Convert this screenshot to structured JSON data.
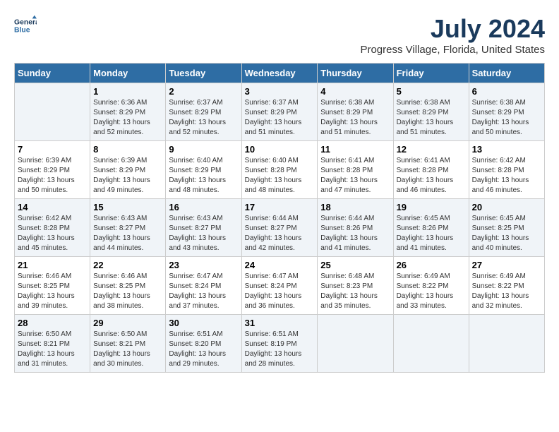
{
  "header": {
    "logo_line1": "General",
    "logo_line2": "Blue",
    "title": "July 2024",
    "subtitle": "Progress Village, Florida, United States"
  },
  "calendar": {
    "days_of_week": [
      "Sunday",
      "Monday",
      "Tuesday",
      "Wednesday",
      "Thursday",
      "Friday",
      "Saturday"
    ],
    "weeks": [
      [
        {
          "day": "",
          "info": ""
        },
        {
          "day": "1",
          "info": "Sunrise: 6:36 AM\nSunset: 8:29 PM\nDaylight: 13 hours\nand 52 minutes."
        },
        {
          "day": "2",
          "info": "Sunrise: 6:37 AM\nSunset: 8:29 PM\nDaylight: 13 hours\nand 52 minutes."
        },
        {
          "day": "3",
          "info": "Sunrise: 6:37 AM\nSunset: 8:29 PM\nDaylight: 13 hours\nand 51 minutes."
        },
        {
          "day": "4",
          "info": "Sunrise: 6:38 AM\nSunset: 8:29 PM\nDaylight: 13 hours\nand 51 minutes."
        },
        {
          "day": "5",
          "info": "Sunrise: 6:38 AM\nSunset: 8:29 PM\nDaylight: 13 hours\nand 51 minutes."
        },
        {
          "day": "6",
          "info": "Sunrise: 6:38 AM\nSunset: 8:29 PM\nDaylight: 13 hours\nand 50 minutes."
        }
      ],
      [
        {
          "day": "7",
          "info": "Sunrise: 6:39 AM\nSunset: 8:29 PM\nDaylight: 13 hours\nand 50 minutes."
        },
        {
          "day": "8",
          "info": "Sunrise: 6:39 AM\nSunset: 8:29 PM\nDaylight: 13 hours\nand 49 minutes."
        },
        {
          "day": "9",
          "info": "Sunrise: 6:40 AM\nSunset: 8:29 PM\nDaylight: 13 hours\nand 48 minutes."
        },
        {
          "day": "10",
          "info": "Sunrise: 6:40 AM\nSunset: 8:28 PM\nDaylight: 13 hours\nand 48 minutes."
        },
        {
          "day": "11",
          "info": "Sunrise: 6:41 AM\nSunset: 8:28 PM\nDaylight: 13 hours\nand 47 minutes."
        },
        {
          "day": "12",
          "info": "Sunrise: 6:41 AM\nSunset: 8:28 PM\nDaylight: 13 hours\nand 46 minutes."
        },
        {
          "day": "13",
          "info": "Sunrise: 6:42 AM\nSunset: 8:28 PM\nDaylight: 13 hours\nand 46 minutes."
        }
      ],
      [
        {
          "day": "14",
          "info": "Sunrise: 6:42 AM\nSunset: 8:28 PM\nDaylight: 13 hours\nand 45 minutes."
        },
        {
          "day": "15",
          "info": "Sunrise: 6:43 AM\nSunset: 8:27 PM\nDaylight: 13 hours\nand 44 minutes."
        },
        {
          "day": "16",
          "info": "Sunrise: 6:43 AM\nSunset: 8:27 PM\nDaylight: 13 hours\nand 43 minutes."
        },
        {
          "day": "17",
          "info": "Sunrise: 6:44 AM\nSunset: 8:27 PM\nDaylight: 13 hours\nand 42 minutes."
        },
        {
          "day": "18",
          "info": "Sunrise: 6:44 AM\nSunset: 8:26 PM\nDaylight: 13 hours\nand 41 minutes."
        },
        {
          "day": "19",
          "info": "Sunrise: 6:45 AM\nSunset: 8:26 PM\nDaylight: 13 hours\nand 41 minutes."
        },
        {
          "day": "20",
          "info": "Sunrise: 6:45 AM\nSunset: 8:25 PM\nDaylight: 13 hours\nand 40 minutes."
        }
      ],
      [
        {
          "day": "21",
          "info": "Sunrise: 6:46 AM\nSunset: 8:25 PM\nDaylight: 13 hours\nand 39 minutes."
        },
        {
          "day": "22",
          "info": "Sunrise: 6:46 AM\nSunset: 8:25 PM\nDaylight: 13 hours\nand 38 minutes."
        },
        {
          "day": "23",
          "info": "Sunrise: 6:47 AM\nSunset: 8:24 PM\nDaylight: 13 hours\nand 37 minutes."
        },
        {
          "day": "24",
          "info": "Sunrise: 6:47 AM\nSunset: 8:24 PM\nDaylight: 13 hours\nand 36 minutes."
        },
        {
          "day": "25",
          "info": "Sunrise: 6:48 AM\nSunset: 8:23 PM\nDaylight: 13 hours\nand 35 minutes."
        },
        {
          "day": "26",
          "info": "Sunrise: 6:49 AM\nSunset: 8:22 PM\nDaylight: 13 hours\nand 33 minutes."
        },
        {
          "day": "27",
          "info": "Sunrise: 6:49 AM\nSunset: 8:22 PM\nDaylight: 13 hours\nand 32 minutes."
        }
      ],
      [
        {
          "day": "28",
          "info": "Sunrise: 6:50 AM\nSunset: 8:21 PM\nDaylight: 13 hours\nand 31 minutes."
        },
        {
          "day": "29",
          "info": "Sunrise: 6:50 AM\nSunset: 8:21 PM\nDaylight: 13 hours\nand 30 minutes."
        },
        {
          "day": "30",
          "info": "Sunrise: 6:51 AM\nSunset: 8:20 PM\nDaylight: 13 hours\nand 29 minutes."
        },
        {
          "day": "31",
          "info": "Sunrise: 6:51 AM\nSunset: 8:19 PM\nDaylight: 13 hours\nand 28 minutes."
        },
        {
          "day": "",
          "info": ""
        },
        {
          "day": "",
          "info": ""
        },
        {
          "day": "",
          "info": ""
        }
      ]
    ]
  }
}
